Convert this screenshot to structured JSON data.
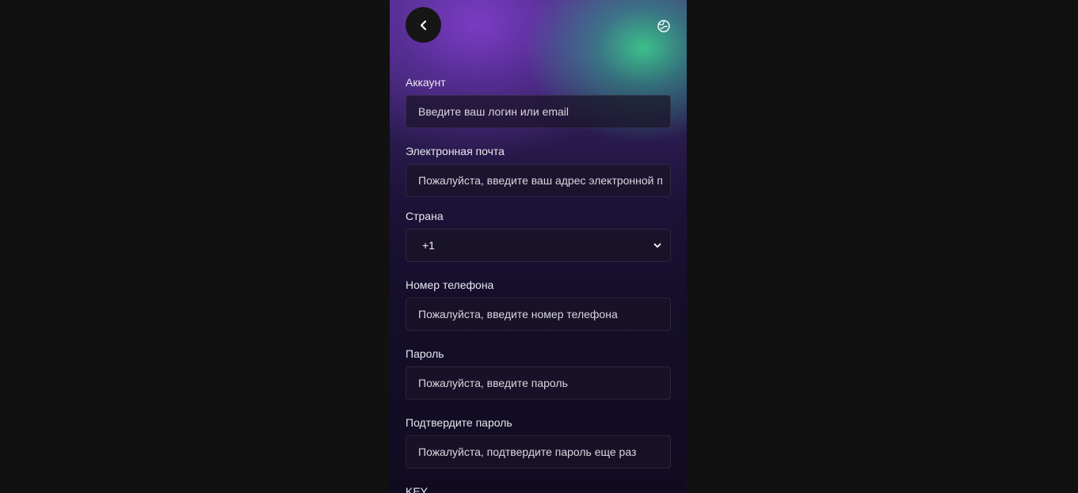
{
  "header": {
    "back_icon": "chevron-left-icon",
    "language_icon": "globe-icon"
  },
  "form": {
    "account": {
      "label": "Аккаунт",
      "placeholder": "Введите ваш логин или email"
    },
    "email": {
      "label": "Электронная почта",
      "placeholder": "Пожалуйста, введите ваш адрес электронной почты"
    },
    "country": {
      "label": "Страна",
      "value": "+1"
    },
    "phone": {
      "label": "Номер телефона",
      "placeholder": "Пожалуйста, введите номер телефона"
    },
    "password": {
      "label": "Пароль",
      "placeholder": "Пожалуйста, введите пароль"
    },
    "confirm_password": {
      "label": "Подтвердите пароль",
      "placeholder": "Пожалуйста, подтвердите пароль еще раз"
    },
    "key": {
      "label": "KEY"
    }
  },
  "colors": {
    "page_background": "#111111",
    "accent_green": "#3cc88c",
    "accent_purple": "#7d3cc8"
  }
}
